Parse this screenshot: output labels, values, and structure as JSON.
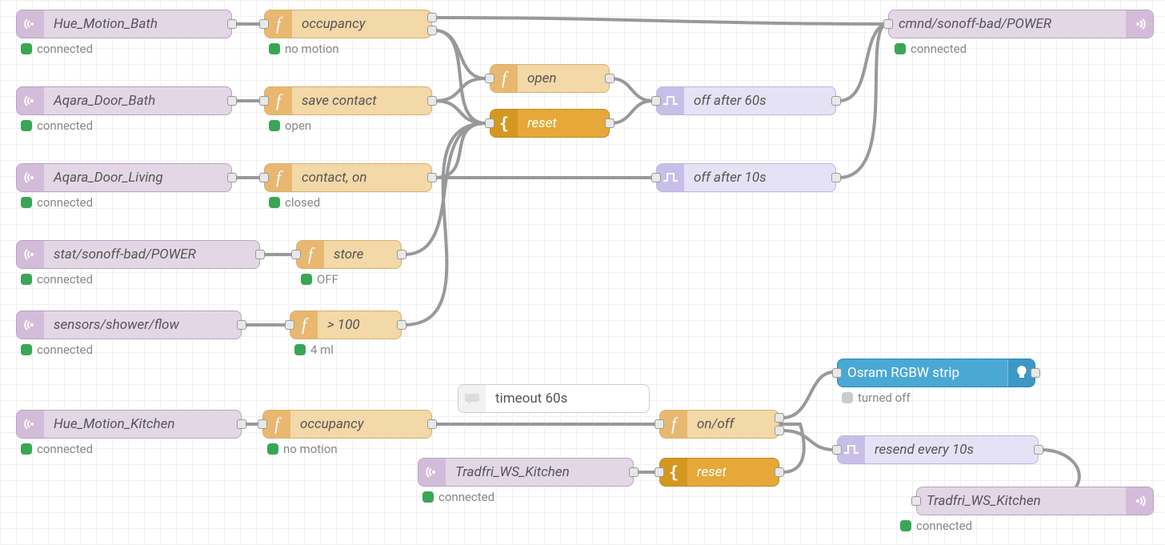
{
  "nodes": {
    "hue_motion_bath": {
      "label": "Hue_Motion_Bath",
      "status": "connected"
    },
    "aqara_door_bath": {
      "label": "Aqara_Door_Bath",
      "status": "connected"
    },
    "aqara_door_living": {
      "label": "Aqara_Door_Living",
      "status": "connected"
    },
    "stat_sonoff": {
      "label": "stat/sonoff-bad/POWER",
      "status": "connected"
    },
    "shower_flow": {
      "label": "sensors/shower/flow",
      "status": "connected"
    },
    "hue_motion_kitchen": {
      "label": "Hue_Motion_Kitchen",
      "status": "connected"
    },
    "occupancy1": {
      "label": "occupancy",
      "status": "no motion"
    },
    "save_contact": {
      "label": "save contact",
      "status": "open"
    },
    "contact_on": {
      "label": "contact, on",
      "status": "closed"
    },
    "store": {
      "label": "store",
      "status": "OFF"
    },
    "gt100": {
      "label": "> 100",
      "status": "4 ml"
    },
    "occupancy2": {
      "label": "occupancy",
      "status": "no motion"
    },
    "open": {
      "label": "open"
    },
    "reset1": {
      "label": "reset"
    },
    "reset2": {
      "label": "reset"
    },
    "onoff": {
      "label": "on/off"
    },
    "off60": {
      "label": "off after 60s"
    },
    "off10": {
      "label": "off after 10s"
    },
    "resend": {
      "label": "resend every 10s"
    },
    "timeout": {
      "label": "timeout 60s"
    },
    "cmnd_sonoff": {
      "label": "cmnd/sonoff-bad/POWER",
      "status": "connected"
    },
    "tradfri_in": {
      "label": "Tradfri_WS_Kitchen",
      "status": "connected"
    },
    "tradfri_out": {
      "label": "Tradfri_WS_Kitchen",
      "status": "connected"
    },
    "osram": {
      "label": "Osram RGBW strip",
      "status": "turned off"
    }
  },
  "status_labels": {
    "connected": "connected",
    "no_motion": "no motion",
    "open": "open",
    "closed": "closed",
    "off": "OFF",
    "ml4": "4 ml",
    "turned_off": "turned off"
  }
}
